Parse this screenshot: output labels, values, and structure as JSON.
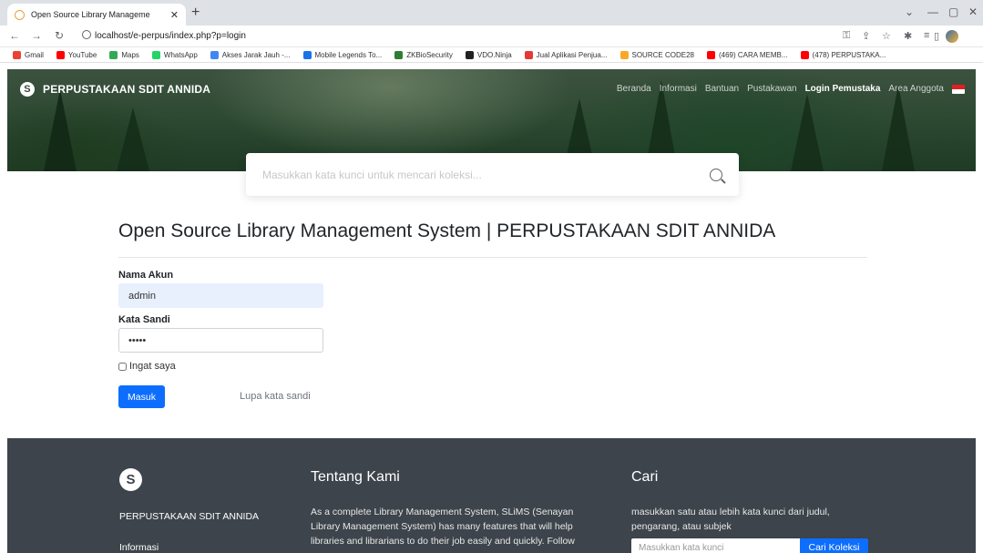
{
  "browser": {
    "tab_title": "Open Source Library Manageme",
    "url": "localhost/e-perpus/index.php?p=login",
    "bookmarks": [
      {
        "label": "Gmail",
        "color": "#ea4335"
      },
      {
        "label": "YouTube",
        "color": "#ff0000"
      },
      {
        "label": "Maps",
        "color": "#34a853"
      },
      {
        "label": "WhatsApp",
        "color": "#25d366"
      },
      {
        "label": "Akses Jarak Jauh -...",
        "color": "#4285f4"
      },
      {
        "label": "Mobile Legends To...",
        "color": "#1a73e8"
      },
      {
        "label": "ZKBioSecurity",
        "color": "#2e7d32"
      },
      {
        "label": "VDO.Ninja",
        "color": "#222222"
      },
      {
        "label": "Jual Aplikasi Penjua...",
        "color": "#e53935"
      },
      {
        "label": "SOURCE CODE28",
        "color": "#f9a825"
      },
      {
        "label": "(469) CARA MEMB...",
        "color": "#ff0000"
      },
      {
        "label": "(478) PERPUSTAKA...",
        "color": "#ff0000"
      }
    ]
  },
  "header": {
    "brand": "PERPUSTAKAAN SDIT ANNIDA",
    "nav": [
      "Beranda",
      "Informasi",
      "Bantuan",
      "Pustakawan",
      "Login Pemustaka",
      "Area Anggota"
    ],
    "active_nav": "Login Pemustaka",
    "search_placeholder": "Masukkan kata kunci untuk mencari koleksi..."
  },
  "login": {
    "title": "Open Source Library Management System | PERPUSTAKAAN SDIT ANNIDA",
    "username_label": "Nama Akun",
    "username_value": "admin",
    "password_label": "Kata Sandi",
    "password_value": "•••••",
    "remember_label": "Ingat saya",
    "submit_label": "Masuk",
    "forgot_label": "Lupa kata sandi"
  },
  "footer": {
    "brand": "PERPUSTAKAAN SDIT ANNIDA",
    "info_label": "Informasi",
    "about_title": "Tentang Kami",
    "about_lines": [
      "As a complete Library Management System, SLiMS (Senayan",
      "Library Management System) has many features that will help",
      "libraries and librarians to do their job easily and quickly. Follow"
    ],
    "search_title": "Cari",
    "search_lines": [
      "masukkan satu atau lebih kata kunci dari judul,",
      "pengarang, atau subjek"
    ],
    "search_placeholder": "Masukkan kata kunci",
    "search_button": "Cari Koleksi"
  }
}
